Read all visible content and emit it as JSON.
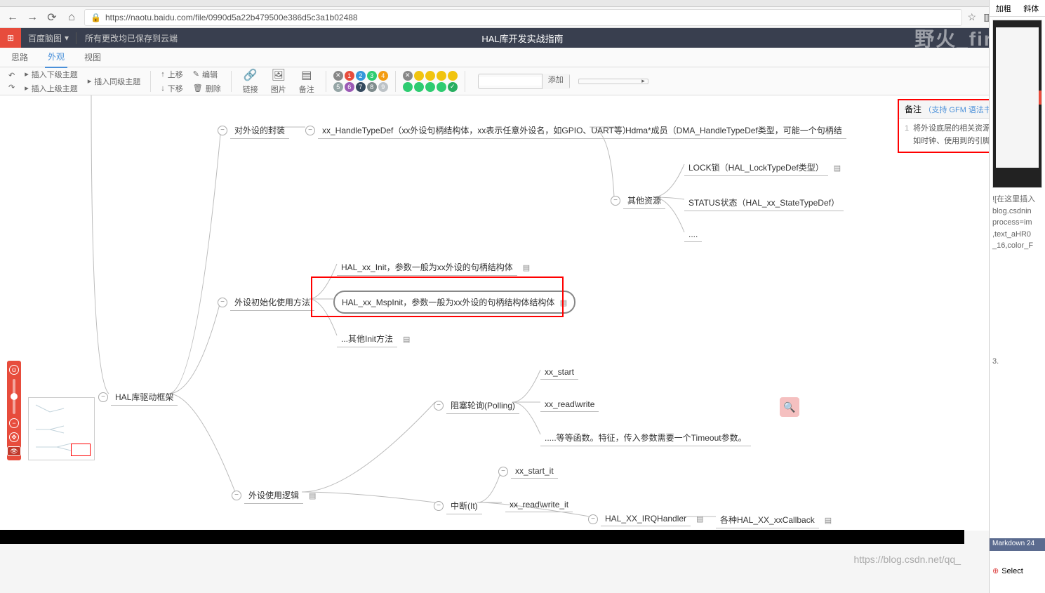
{
  "browser": {
    "url": "https://naotu.baidu.com/file/0990d5a22b479500e386d5c3a1b02488",
    "back_icon": "←",
    "forward_icon": "→",
    "reload_icon": "⟳",
    "home_icon": "⌂",
    "lock_icon": "🔒"
  },
  "header": {
    "brand": "百度脑图",
    "dropdown": "▾",
    "status": "所有更改均已保存到云端",
    "doc_title": "HAL库开发实战指南",
    "watermark": "野火_firege"
  },
  "tabs": {
    "t1": "思路",
    "t2": "外观",
    "t3": "视图"
  },
  "toolbar": {
    "undo": "↶",
    "redo": "↷",
    "insert_sub": "插入下级主题",
    "insert_sibling": "插入上级主题",
    "insert_same": "插入同级主题",
    "up": "上移",
    "down": "下移",
    "edit": "编辑",
    "delete": "删除",
    "link": "链接",
    "image": "图片",
    "note": "备注",
    "search_btn": "添加",
    "search_placeholder": ""
  },
  "priority_colors": {
    "r1": [
      "#888",
      "#e74c3c",
      "#3498db",
      "#2ecc71",
      "#f39c12"
    ],
    "r2": [
      "#95a5a6",
      "#9b59b6",
      "#34495e",
      "#7f8c8d",
      "#bdc3c7"
    ],
    "labels1": [
      "✕",
      "1",
      "2",
      "3",
      "4"
    ],
    "labels2": [
      "5",
      "6",
      "7",
      "8",
      "9"
    ]
  },
  "progress_colors": {
    "r1": [
      "#888",
      "#f1c40f",
      "#f1c40f",
      "#f1c40f",
      "#f1c40f"
    ],
    "r2": [
      "#2ecc71",
      "#2ecc71",
      "#2ecc71",
      "#2ecc71",
      "#27ae60"
    ],
    "labels1": [
      "✕",
      "",
      "",
      "",
      ""
    ],
    "labels2": [
      "",
      "",
      "",
      "",
      "✓"
    ]
  },
  "nodes": {
    "root": "HAL库驱动框架",
    "n1": "对外设的封装",
    "n1_1": "xx_HandleTypeDef（xx外设句柄结构体，xx表示任意外设名，如GPIO、UART等）",
    "n1_1_1": "Hdma*成员（DMA_HandleTypeDef类型，可能一个句柄结",
    "n1_1_2": "其他资源",
    "n1_1_2_1": "LOCK锁（HAL_LockTypeDef类型）",
    "n1_1_2_2": "STATUS状态（HAL_xx_StateTypeDef）",
    "n1_1_2_3": "....",
    "n2": "外设初始化使用方法",
    "n2_1": "HAL_xx_Init，参数一般为xx外设的句柄结构体",
    "n2_2": "HAL_xx_MspInit，参数一般为xx外设的句柄结构体结构体",
    "n2_3": "...其他Init方法",
    "n3": "外设使用逻辑",
    "n3_1": "阻塞轮询(Polling)",
    "n3_1_1": "xx_start",
    "n3_1_2": "xx_read\\write",
    "n3_1_3": ".....等等函数。特征，传入参数需要一个Timeout参数。",
    "n3_2": "中断(It)",
    "n3_2_1": "xx_start_it",
    "n3_2_2": "xx_read\\write_it",
    "n3_2_3": "HAL_XX_IRQHandler",
    "n3_2_4": "各种HAL_XX_xxCallback"
  },
  "note_panel": {
    "title": "备注",
    "link": "（支持 GFM 语法书写）",
    "close": "✕",
    "line_num": "1",
    "content": "将外设底层的相关资源初始化完成，如时钟、使用到的引脚等。"
  },
  "side_panel": {
    "rs_tab1": "加粗",
    "rs_tab2": "斜体",
    "text1": "![在这里插入",
    "text2": "blog.csdnin",
    "text3": "process=im",
    "text4": ",text_aHR0",
    "text5": "_16,color_F",
    "list_num": "3.",
    "footer": "Markdown  24",
    "select": "Select"
  },
  "blog_url": "https://blog.csdn.net/qq_",
  "toggle_minus": "−",
  "toggle_plus": "+",
  "note_glyph": "▤"
}
